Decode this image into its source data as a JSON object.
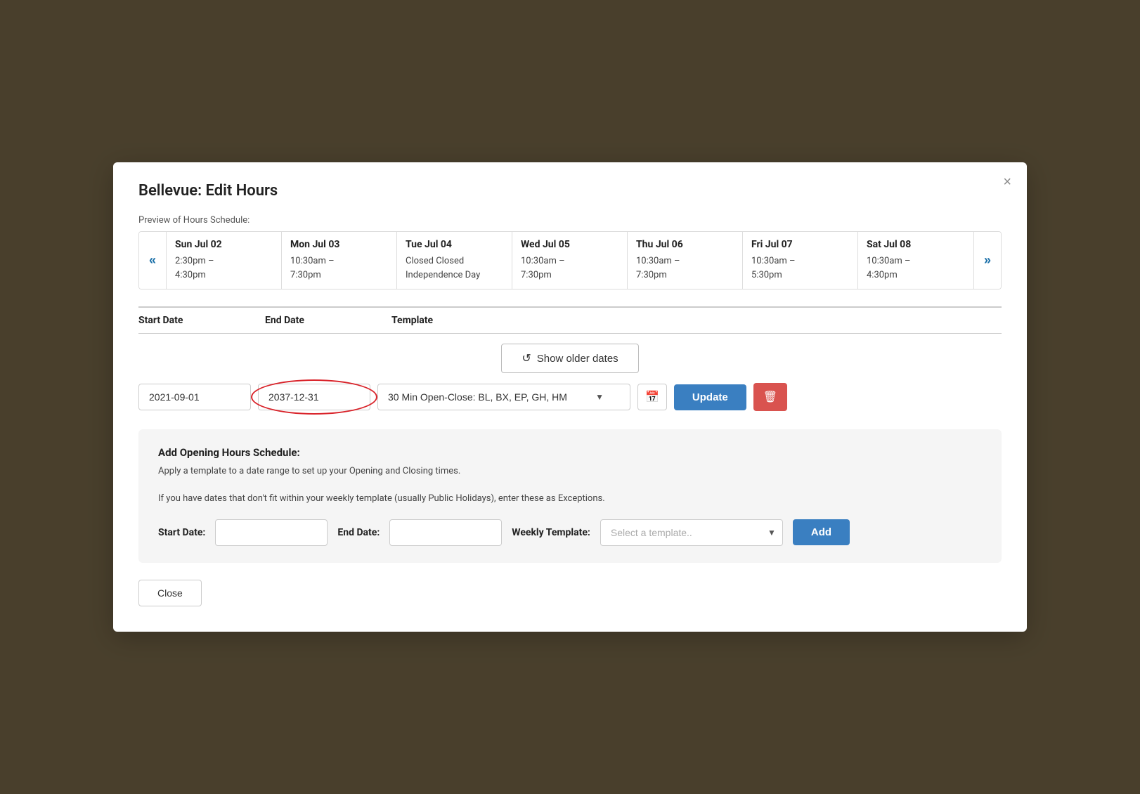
{
  "modal": {
    "title": "Bellevue: Edit Hours",
    "close_label": "×"
  },
  "preview": {
    "section_label": "Preview of Hours Schedule:",
    "prev_arrow": "«",
    "next_arrow": "»",
    "days": [
      {
        "header": "Sun Jul 02",
        "content": "2:30pm –\n4:30pm"
      },
      {
        "header": "Mon Jul 03",
        "content": "10:30am –\n7:30pm"
      },
      {
        "header": "Tue Jul 04",
        "content": "Closed Closed\nIndependence Day"
      },
      {
        "header": "Wed Jul 05",
        "content": "10:30am –\n7:30pm"
      },
      {
        "header": "Thu Jul 06",
        "content": "10:30am –\n7:30pm"
      },
      {
        "header": "Fri Jul 07",
        "content": "10:30am –\n5:30pm"
      },
      {
        "header": "Sat Jul 08",
        "content": "10:30am –\n4:30pm"
      }
    ]
  },
  "table": {
    "col_start": "Start Date",
    "col_end": "End Date",
    "col_template": "Template"
  },
  "show_older_btn": "Show older dates",
  "schedule_row": {
    "start_date": "2021-09-01",
    "end_date": "2037-12-31",
    "template_value": "30 Min Open-Close: BL, BX, EP, GH, HM",
    "update_label": "Update",
    "delete_icon": "🗑"
  },
  "add_section": {
    "title": "Add Opening Hours Schedule:",
    "desc_line1": "Apply a template to a date range to set up your Opening and Closing times.",
    "desc_line2": "If you have dates that don't fit within your weekly template (usually Public Holidays), enter these as Exceptions.",
    "start_date_label": "Start Date:",
    "end_date_label": "End Date:",
    "weekly_template_label": "Weekly Template:",
    "template_placeholder": "Select a template..",
    "add_label": "Add",
    "start_date_value": "",
    "end_date_value": ""
  },
  "footer": {
    "close_label": "Close"
  }
}
